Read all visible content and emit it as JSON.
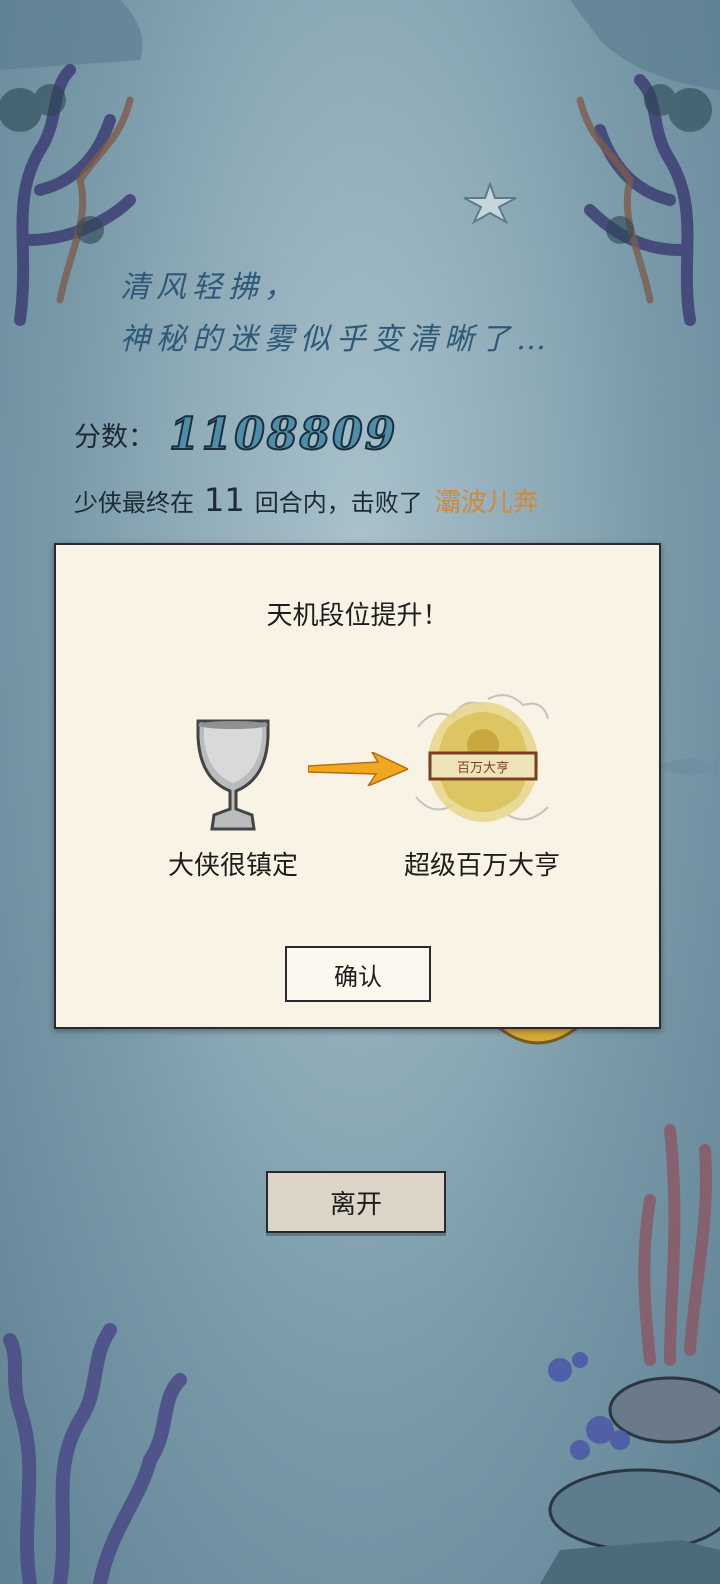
{
  "poem": {
    "line1": "清风轻拂，",
    "line2": "神秘的迷雾似乎变清晰了…"
  },
  "score": {
    "label": "分数：",
    "value": "1108809"
  },
  "result": {
    "prefix": "少侠最终在",
    "rounds": "11",
    "middle": "回合内，击败了",
    "enemy": "灞波儿奔"
  },
  "dialog": {
    "title": "天机段位提升！",
    "old_rank": "大侠很镇定",
    "new_rank": "超级百万大亨",
    "new_rank_badge_text": "百万大亨",
    "confirm_label": "确认"
  },
  "leave_label": "离开",
  "colors": {
    "score": "#4e8ea8",
    "enemy": "#d08a3a",
    "dialog_bg": "#f8f3e5",
    "arrow": "#f0a81e"
  },
  "icons": {
    "old_rank": "silver-goblet-icon",
    "arrow": "right-arrow-icon",
    "new_rank": "golden-dragon-badge-icon"
  }
}
